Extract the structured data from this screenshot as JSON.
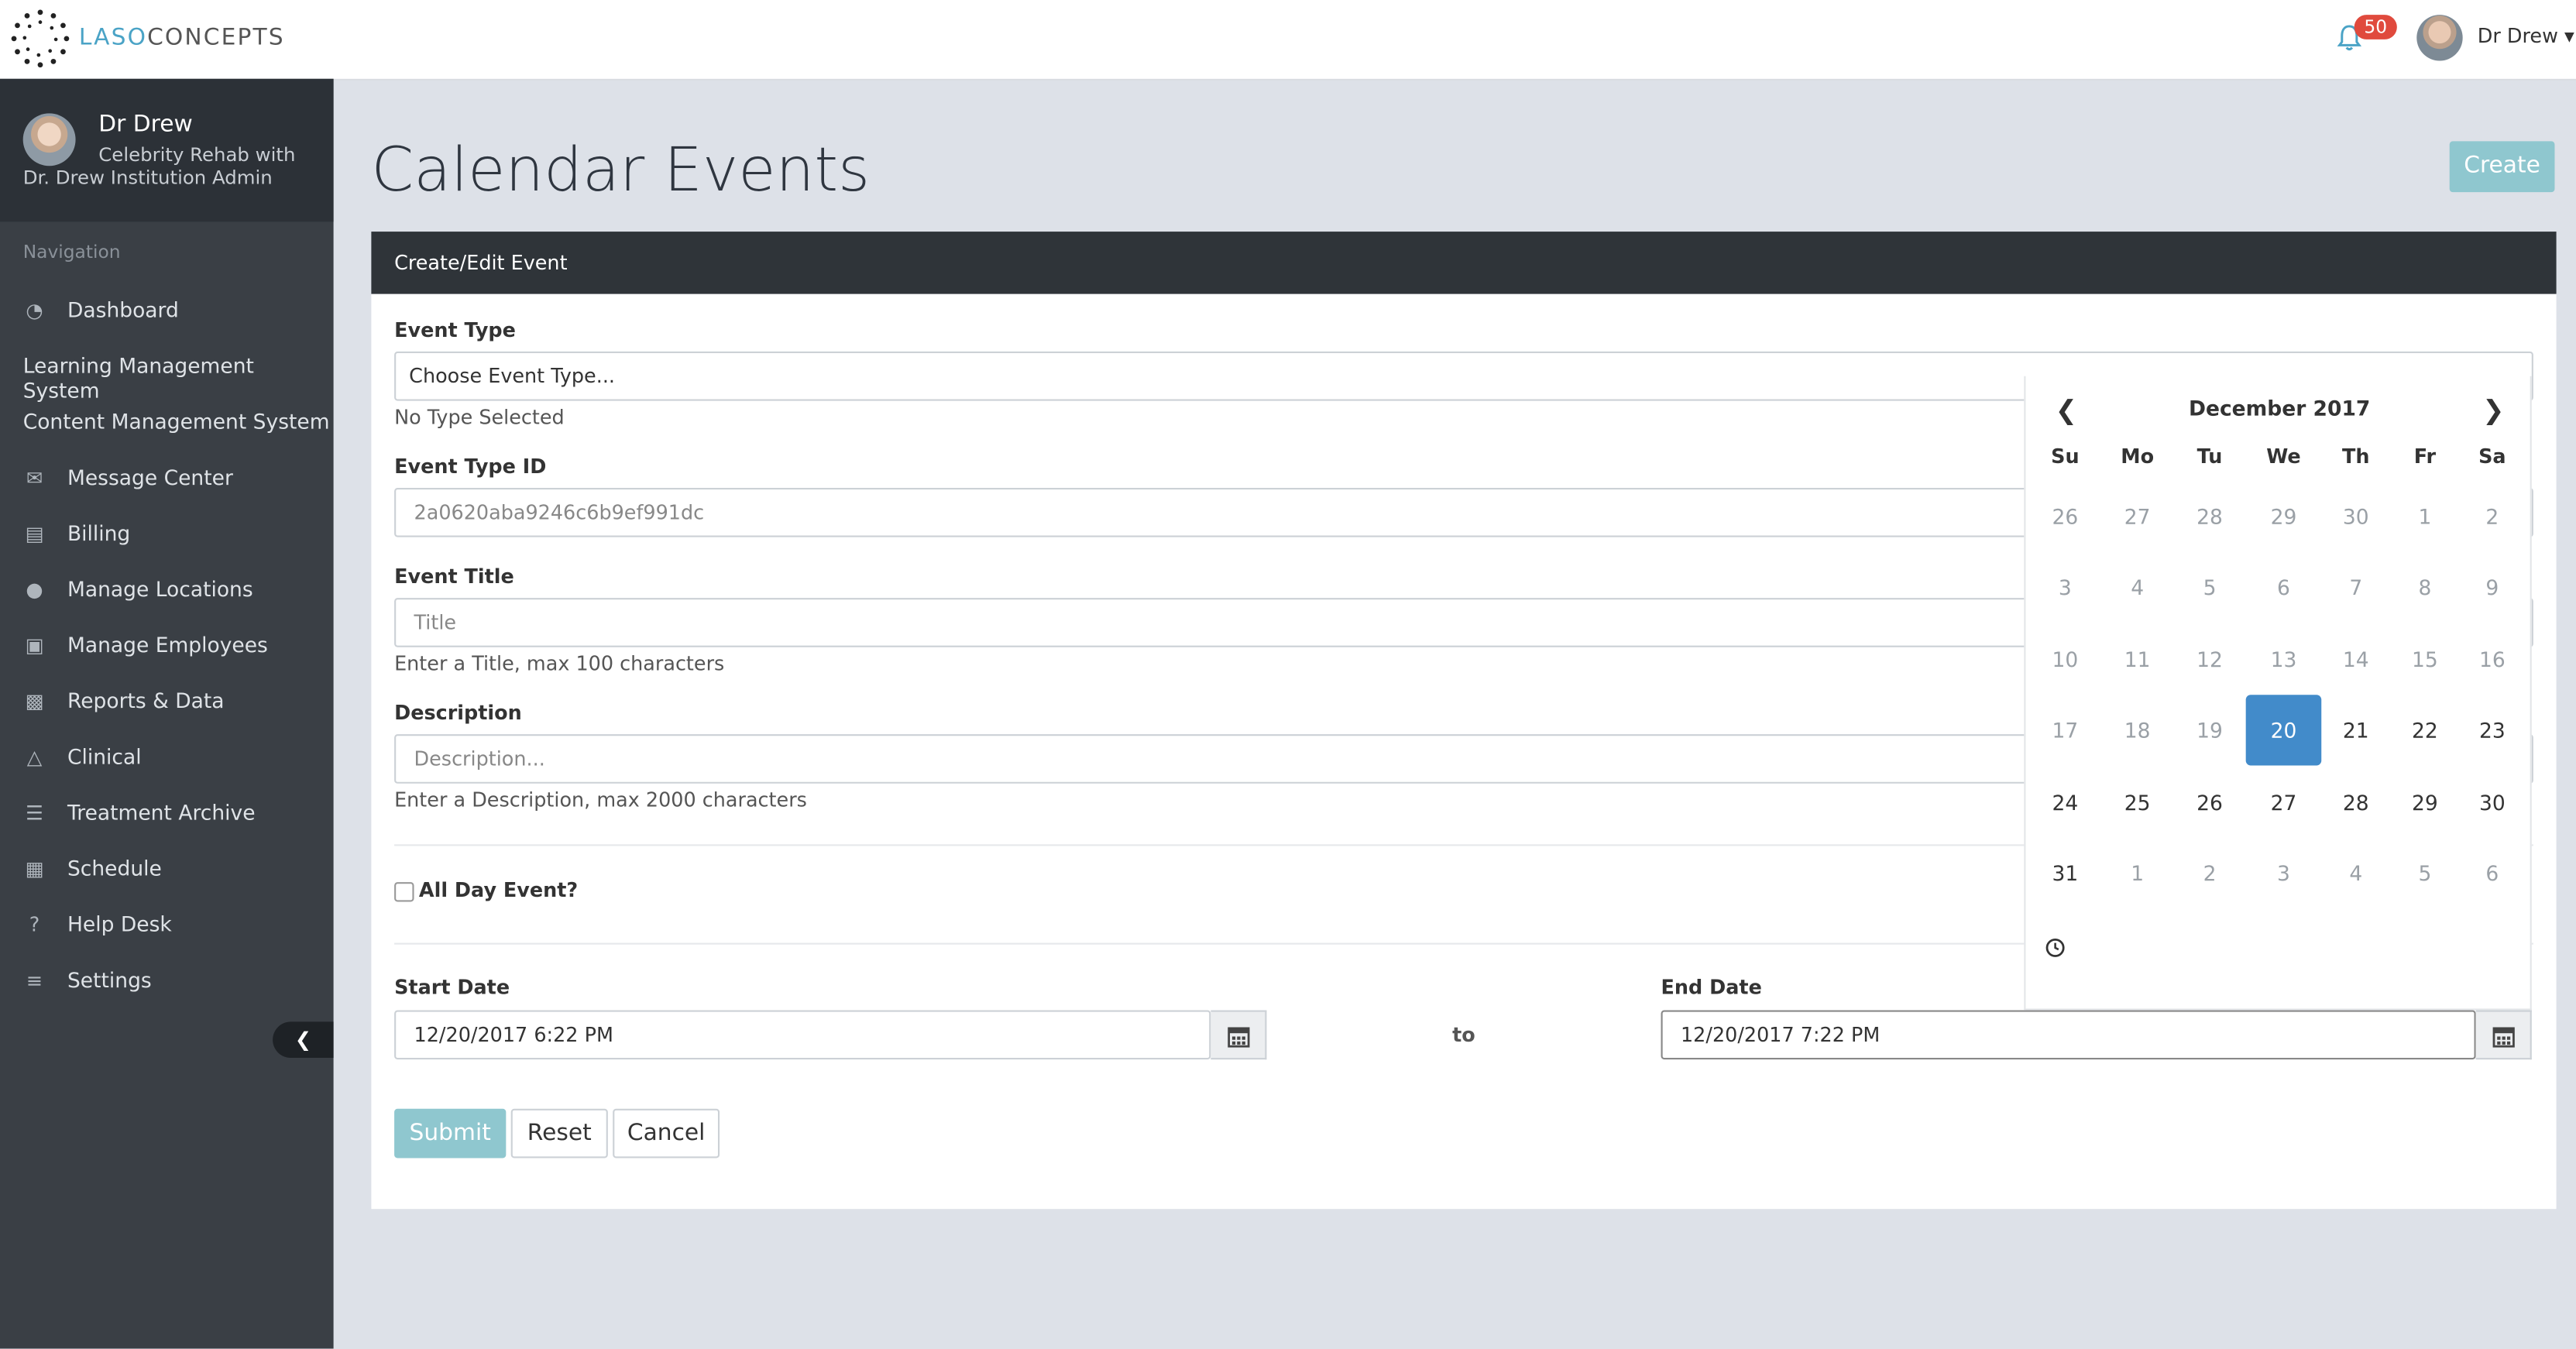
{
  "topbar": {
    "brand_a": "LASO",
    "brand_b": "CONCEPTS",
    "notification_count": "50",
    "user_name": "Dr Drew"
  },
  "sidebar": {
    "profile_name": "Dr Drew",
    "profile_sub1": "Celebrity Rehab with",
    "profile_sub2": "Dr. Drew Institution Admin",
    "nav_label": "Navigation",
    "items": [
      {
        "label": "Dashboard",
        "icon": "dashboard-icon"
      },
      {
        "label": "Learning Management System",
        "icon": ""
      },
      {
        "label": "Content Management System",
        "icon": ""
      },
      {
        "label": "Message Center",
        "icon": "envelope-icon"
      },
      {
        "label": "Billing",
        "icon": "money-icon"
      },
      {
        "label": "Manage Locations",
        "icon": "map-marker-icon"
      },
      {
        "label": "Manage Employees",
        "icon": "briefcase-icon"
      },
      {
        "label": "Reports & Data",
        "icon": "bar-chart-icon"
      },
      {
        "label": "Clinical",
        "icon": "flask-icon"
      },
      {
        "label": "Treatment Archive",
        "icon": "database-icon"
      },
      {
        "label": "Schedule",
        "icon": "calendar-icon"
      },
      {
        "label": "Help Desk",
        "icon": "question-circle-icon"
      },
      {
        "label": "Settings",
        "icon": "sliders-icon"
      }
    ]
  },
  "main": {
    "title": "Calendar Events",
    "create_label": "Create",
    "panel_title": "Create/Edit Event",
    "event_type_label": "Event Type",
    "event_type_value": "Choose Event Type...",
    "event_type_help": "No Type Selected",
    "event_type_id_label": "Event Type ID",
    "event_type_id_value": "2a0620aba9246c6b9ef991dc",
    "event_title_label": "Event Title",
    "event_title_placeholder": "Title",
    "event_title_help": "Enter a Title, max 100 characters",
    "description_label": "Description",
    "description_placeholder": "Description...",
    "description_help": "Enter a Description, max 2000 characters",
    "all_day_label": "All Day Event?",
    "all_day_checked": false,
    "start_date_label": "Start Date",
    "start_date_value": "12/20/2017 6:22 PM",
    "to_label": "to",
    "end_date_label": "End Date",
    "end_date_value": "12/20/2017 7:22 PM",
    "submit_label": "Submit",
    "reset_label": "Reset",
    "cancel_label": "Cancel"
  },
  "datepicker": {
    "month_label": "December 2017",
    "weekdays": [
      "Su",
      "Mo",
      "Tu",
      "We",
      "Th",
      "Fr",
      "Sa"
    ],
    "weeks": [
      [
        {
          "d": "26",
          "t": "old"
        },
        {
          "d": "27",
          "t": "old"
        },
        {
          "d": "28",
          "t": "old"
        },
        {
          "d": "29",
          "t": "old"
        },
        {
          "d": "30",
          "t": "old"
        },
        {
          "d": "1",
          "t": "old"
        },
        {
          "d": "2",
          "t": "old"
        }
      ],
      [
        {
          "d": "3",
          "t": "old"
        },
        {
          "d": "4",
          "t": "old"
        },
        {
          "d": "5",
          "t": "old"
        },
        {
          "d": "6",
          "t": "old"
        },
        {
          "d": "7",
          "t": "old"
        },
        {
          "d": "8",
          "t": "old"
        },
        {
          "d": "9",
          "t": "old"
        }
      ],
      [
        {
          "d": "10",
          "t": "old"
        },
        {
          "d": "11",
          "t": "old"
        },
        {
          "d": "12",
          "t": "old"
        },
        {
          "d": "13",
          "t": "old"
        },
        {
          "d": "14",
          "t": "old"
        },
        {
          "d": "15",
          "t": "old"
        },
        {
          "d": "16",
          "t": "old"
        }
      ],
      [
        {
          "d": "17",
          "t": "old"
        },
        {
          "d": "18",
          "t": "old"
        },
        {
          "d": "19",
          "t": "old"
        },
        {
          "d": "20",
          "t": "sel"
        },
        {
          "d": "21",
          "t": "cur"
        },
        {
          "d": "22",
          "t": "cur"
        },
        {
          "d": "23",
          "t": "cur"
        }
      ],
      [
        {
          "d": "24",
          "t": "cur"
        },
        {
          "d": "25",
          "t": "cur"
        },
        {
          "d": "26",
          "t": "cur"
        },
        {
          "d": "27",
          "t": "cur"
        },
        {
          "d": "28",
          "t": "cur"
        },
        {
          "d": "29",
          "t": "cur"
        },
        {
          "d": "30",
          "t": "cur"
        }
      ],
      [
        {
          "d": "31",
          "t": "cur"
        },
        {
          "d": "1",
          "t": "old"
        },
        {
          "d": "2",
          "t": "old"
        },
        {
          "d": "3",
          "t": "old"
        },
        {
          "d": "4",
          "t": "old"
        },
        {
          "d": "5",
          "t": "old"
        },
        {
          "d": "6",
          "t": "old"
        }
      ]
    ]
  },
  "colors": {
    "accent": "#8fc7cf",
    "selected_day": "#428bca",
    "sidebar_bg": "#3a3f45",
    "badge": "#e04a3d"
  }
}
